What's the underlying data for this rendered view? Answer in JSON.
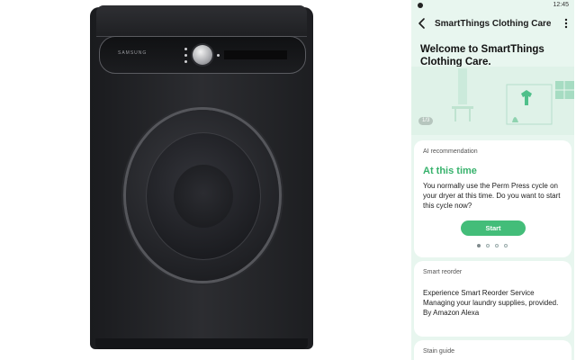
{
  "product": {
    "brand": "SAMSUNG"
  },
  "status_bar": {
    "time": "12:45"
  },
  "app_bar": {
    "title": "SmartThings Clothing Care"
  },
  "welcome": {
    "title": "Welcome to SmartThings Clothing Care.",
    "page_indicator": "1/3"
  },
  "ai_card": {
    "label": "AI recommendation",
    "heading": "At this time",
    "body": "You normally use the Perm Press cycle on your dryer at this time. Do you want to start this cycle now?",
    "start_label": "Start",
    "carousel_total": 4,
    "carousel_active": 1
  },
  "reorder_card": {
    "label": "Smart reorder",
    "line1": "Experience Smart Reorder Service",
    "line2": "Managing your laundry supplies, provided.",
    "line3": "By Amazon Alexa"
  },
  "stain_card": {
    "label": "Stain guide"
  },
  "colors": {
    "accent": "#43bd79",
    "heading_green": "#37b26c",
    "screen_bg": "#e8f6ef",
    "washer_body": "#1f2023"
  },
  "icons": {
    "back": "back-arrow-icon",
    "more": "more-vertical-icon"
  }
}
